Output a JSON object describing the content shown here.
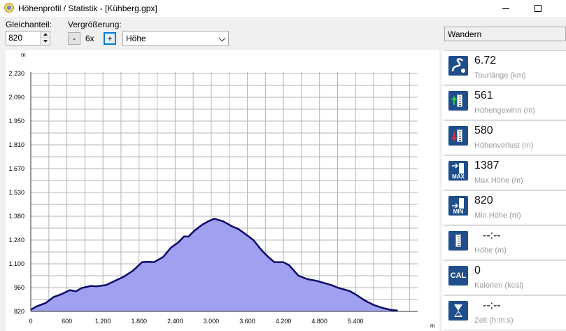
{
  "window": {
    "title": "Höhenprofil / Statistik - [Kühberg.gpx]"
  },
  "toolbar": {
    "offset_label": "Gleichanteil:",
    "offset_value": "820",
    "zoom_label": "Vergrößerung:",
    "zoom_minus": "-",
    "zoom_value": "6x",
    "zoom_plus": "+",
    "profile_type": "Höhe"
  },
  "activity": {
    "selected": "Wandern"
  },
  "chart_data": {
    "type": "area",
    "xlabel": "m",
    "ylabel": "m",
    "x_ticks": [
      "0",
      "600",
      "1.200",
      "1.800",
      "2.400",
      "3.000",
      "3.600",
      "4.200",
      "4.800",
      "5.400"
    ],
    "y_ticks": [
      "820",
      "960",
      "1.100",
      "1.240",
      "1.380",
      "1.530",
      "1.670",
      "1.810",
      "1.950",
      "2.090",
      "2.230"
    ],
    "xlim": [
      0,
      6400
    ],
    "ylim": [
      820,
      2230
    ],
    "grid": true,
    "fill_color": "#a0a0f0",
    "line_color": "#0b0b6b",
    "series": [
      {
        "x": [
          0,
          100,
          250,
          380,
          500,
          650,
          750,
          850,
          1000,
          1100,
          1250,
          1400,
          1550,
          1700,
          1850,
          1950,
          2050,
          2200,
          2330,
          2450,
          2550,
          2620,
          2720,
          2850,
          2950,
          3050,
          3200,
          3350,
          3450,
          3550,
          3700,
          3850,
          3950,
          4050,
          4200,
          4300,
          4450,
          4600,
          4750,
          4900,
          5000,
          5100,
          5300,
          5400,
          5550,
          5700,
          5850,
          6000,
          6100
        ],
        "y": [
          830,
          850,
          870,
          905,
          920,
          945,
          938,
          958,
          970,
          968,
          975,
          1000,
          1025,
          1060,
          1110,
          1112,
          1110,
          1140,
          1195,
          1225,
          1262,
          1260,
          1295,
          1330,
          1350,
          1365,
          1350,
          1320,
          1305,
          1280,
          1240,
          1175,
          1140,
          1110,
          1110,
          1090,
          1030,
          1010,
          1000,
          985,
          975,
          960,
          940,
          920,
          885,
          858,
          840,
          828,
          825
        ]
      }
    ]
  },
  "stats": [
    {
      "value": "6.72",
      "label": "Tourlänge (km)",
      "icon": "tour-length-icon"
    },
    {
      "value": "561",
      "label": "Höhengewinn (m)",
      "icon": "elevation-gain-icon"
    },
    {
      "value": "580",
      "label": "Höhenverlust (m)",
      "icon": "elevation-loss-icon"
    },
    {
      "value": "1387",
      "label": "Max.Höhe (m)",
      "icon": "max-elevation-icon",
      "badge": "MAX"
    },
    {
      "value": "820",
      "label": "Min.Höhe (m)",
      "icon": "min-elevation-icon",
      "badge": "MIN"
    },
    {
      "value": "--:--",
      "label": "Höhe (m)",
      "icon": "elevation-icon"
    },
    {
      "value": "0",
      "label": "Kalorien (kcal)",
      "icon": "calories-icon",
      "badge": "CAL"
    },
    {
      "value": "--:--",
      "label": "Zeit (h:m:s)",
      "icon": "hourglass-icon"
    }
  ]
}
